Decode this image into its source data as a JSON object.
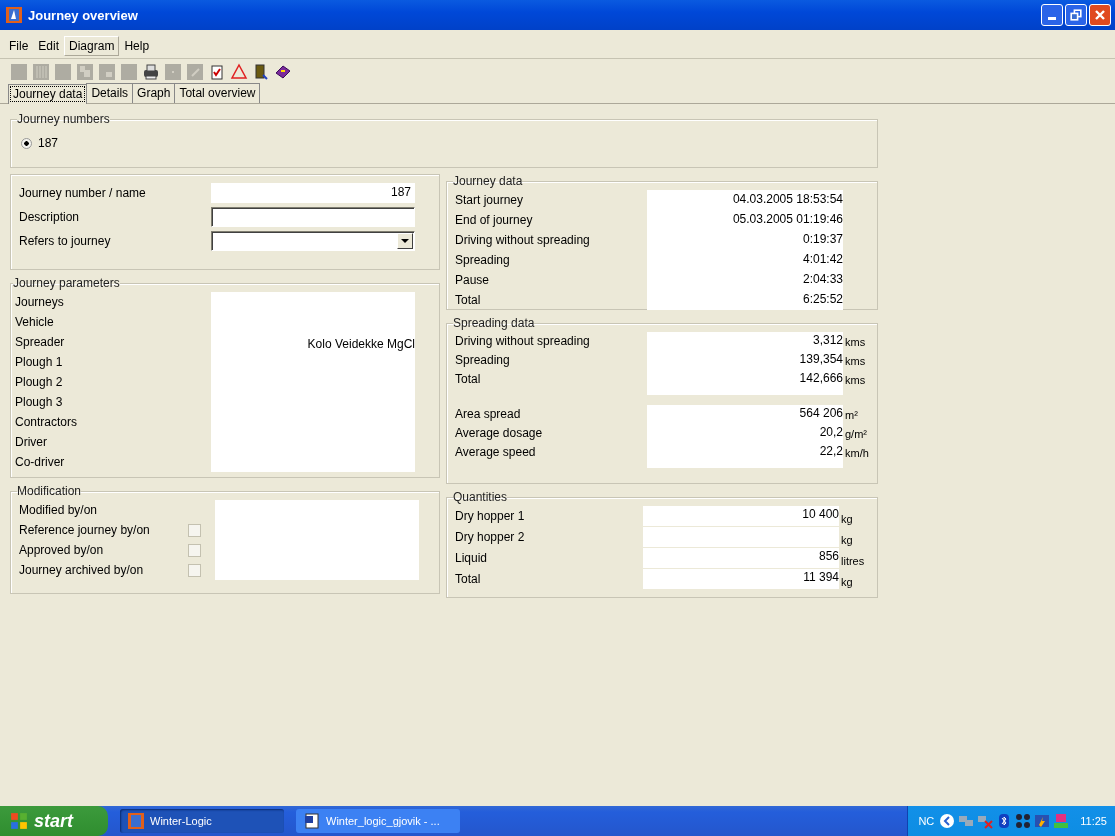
{
  "window": {
    "title": "Journey overview"
  },
  "menu": [
    {
      "label": "File",
      "selected": false
    },
    {
      "label": "Edit",
      "selected": false
    },
    {
      "label": "Diagram",
      "selected": true
    },
    {
      "label": "Help",
      "selected": false
    }
  ],
  "toolbar": [
    {
      "kind": "blank",
      "disabled": true
    },
    {
      "kind": "grid",
      "disabled": true
    },
    {
      "kind": "blank",
      "disabled": true
    },
    {
      "kind": "copy",
      "disabled": true
    },
    {
      "kind": "paste",
      "disabled": true
    },
    {
      "kind": "blank",
      "disabled": true
    },
    {
      "kind": "printer",
      "disabled": false
    },
    {
      "kind": "dot",
      "disabled": true
    },
    {
      "kind": "pen",
      "disabled": true
    },
    {
      "kind": "checklist",
      "disabled": false
    },
    {
      "kind": "triangle",
      "disabled": false
    },
    {
      "kind": "exit",
      "disabled": false
    },
    {
      "kind": "book",
      "disabled": false
    }
  ],
  "tabs": [
    {
      "label": "Journey data",
      "selected": true
    },
    {
      "label": "Details",
      "selected": false
    },
    {
      "label": "Graph",
      "selected": false
    },
    {
      "label": "Total overview",
      "selected": false
    }
  ],
  "journey_numbers": {
    "title": "Journey numbers",
    "options": [
      {
        "label": "187",
        "selected": true
      }
    ]
  },
  "identity": {
    "number_label": "Journey number / name",
    "number_value": "187",
    "description_label": "Description",
    "refers_label": "Refers to journey"
  },
  "parameters": {
    "title": "Journey parameters",
    "rows": [
      {
        "label": "Journeys"
      },
      {
        "label": "Vehicle"
      },
      {
        "label": "Spreader",
        "value": "Kolo Veidekke MgCl"
      },
      {
        "label": "Plough 1"
      },
      {
        "label": "Plough 2"
      },
      {
        "label": "Plough 3"
      },
      {
        "label": "Contractors"
      },
      {
        "label": "Driver"
      },
      {
        "label": "Co-driver"
      }
    ]
  },
  "modification": {
    "title": "Modification",
    "rows": [
      {
        "label": "Modified by/on",
        "kind": "text"
      },
      {
        "label": "Reference journey by/on",
        "kind": "checkbox",
        "checked": false
      },
      {
        "label": "Approved by/on",
        "kind": "checkbox",
        "checked": false
      },
      {
        "label": "Journey archived by/on",
        "kind": "checkbox",
        "checked": false
      }
    ]
  },
  "journey_data": {
    "title": "Journey data",
    "rows": [
      {
        "label": "Start journey",
        "value": "04.03.2005 18:53:54"
      },
      {
        "label": "End of journey",
        "value": "05.03.2005 01:19:46"
      },
      {
        "label": "Driving without spreading",
        "value": "0:19:37"
      },
      {
        "label": "Spreading",
        "value": "4:01:42"
      },
      {
        "label": "Pause",
        "value": "2:04:33"
      },
      {
        "label": "Total",
        "value": "6:25:52"
      }
    ]
  },
  "spreading_data": {
    "title": "Spreading data",
    "groups": [
      [
        {
          "label": "Driving without spreading",
          "value": "3,312",
          "unit": "kms"
        },
        {
          "label": "Spreading",
          "value": "139,354",
          "unit": "kms"
        },
        {
          "label": "Total",
          "value": "142,666",
          "unit": "kms"
        }
      ],
      [
        {
          "label": "Area spread",
          "value": "564 206",
          "unit": "m²"
        },
        {
          "label": "Average dosage",
          "value": "20,2",
          "unit": "g/m²"
        },
        {
          "label": "Average speed",
          "value": "22,2",
          "unit": "km/h"
        }
      ]
    ]
  },
  "quantities": {
    "title": "Quantities",
    "rows": [
      {
        "label": "Dry hopper 1",
        "value": "10 400",
        "unit": "kg"
      },
      {
        "label": "Dry hopper 2",
        "unit": "kg"
      },
      {
        "label": "Liquid",
        "value": "856",
        "unit": "litres"
      },
      {
        "label": "Total",
        "value": "11 394",
        "unit": "kg"
      }
    ]
  },
  "taskbar": {
    "start": "start",
    "tasks": [
      {
        "label": "Winter-Logic",
        "kind": "app",
        "selected": true
      },
      {
        "label": "Winter_logic_gjovik - ...",
        "kind": "word",
        "selected": false
      }
    ],
    "tray_text": "NC",
    "clock": "11:25"
  }
}
